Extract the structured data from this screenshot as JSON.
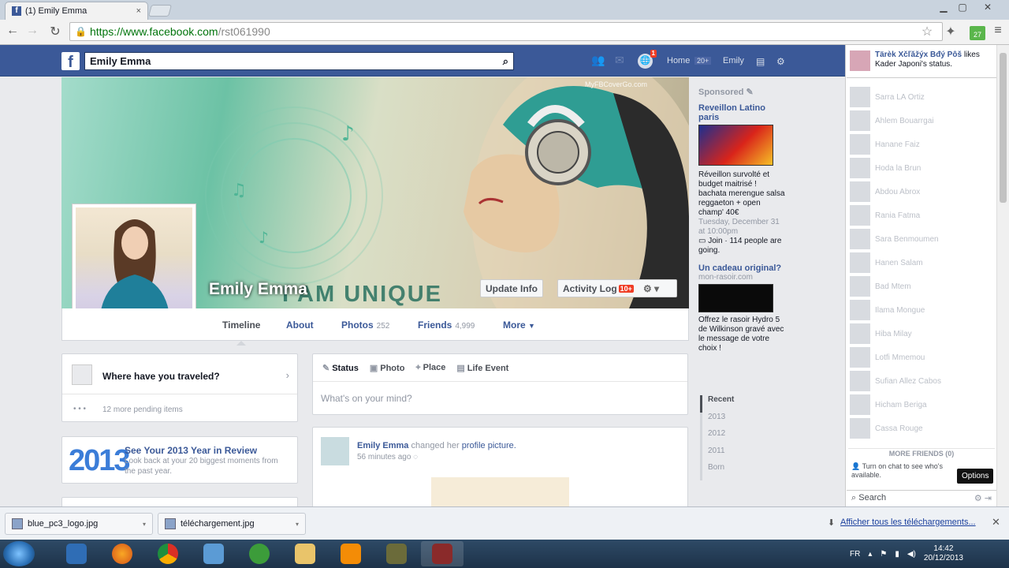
{
  "browser": {
    "tab_title": "(1) Emily Emma",
    "tab_close": "×",
    "url_host": "https://www.facebook.com",
    "url_path": "/rst061990",
    "extension_badge": "27"
  },
  "fb_header": {
    "logo": "f",
    "search_value": "Emily Emma",
    "notif_count": "1",
    "home_label": "Home",
    "home_count": "20+",
    "user_label": "Emily"
  },
  "cover": {
    "name": "Emily Emma",
    "overlay_text": "I AM UNIQUE",
    "watermark": "MyFBCoverGo.com",
    "update_info": "Update Info",
    "activity_log": "Activity Log",
    "activity_badge": "10+"
  },
  "profile_nav": {
    "timeline": "Timeline",
    "about": "About",
    "photos": "Photos",
    "photos_count": "252",
    "friends": "Friends",
    "friends_count": "4,999",
    "more": "More"
  },
  "travel_card": {
    "question": "Where have you traveled?",
    "pending": "12 more pending items"
  },
  "year_card": {
    "big": "2013",
    "title": "See Your 2013 Year in Review",
    "subtitle": "Look back at your 20 biggest moments from the past year."
  },
  "composer": {
    "status": "Status",
    "photo": "Photo",
    "place": "Place",
    "life_event": "Life Event",
    "placeholder": "What's on your mind?"
  },
  "story": {
    "author": "Emily Emma",
    "action": "changed her",
    "object": "profile picture.",
    "time": "56 minutes ago"
  },
  "ads": {
    "header": "Sponsored",
    "ad1_title": "Reveillon Latino paris",
    "ad1_body": "Réveillon survolté et budget maitrisé ! bachata merengue salsa reggaeton + open champ' 40€",
    "ad1_date": "Tuesday, December 31 at 10:00pm",
    "ad1_join": "Join · 114 people are going.",
    "ad2_title": "Un cadeau original?",
    "ad2_domain": "mon-rasoir.com",
    "ad2_body": "Offrez le rasoir Hydro 5 de Wilkinson gravé avec le message de votre choix !"
  },
  "years": [
    "Recent",
    "2013",
    "2012",
    "2011",
    "Born"
  ],
  "chat": {
    "ticker_name": "Tärèk Xčľǎžýx Bđý Pôš",
    "ticker_text": "likes Kader Japoni's status.",
    "friends": [
      "Sarra LA Ortiz",
      "Ahlem Bouarrgai",
      "Hanane Faiz",
      "Hoda la Brun",
      "Abdou Abrox",
      "Rania Fatma",
      "Sara Benmoumen",
      "Hanen Salam",
      "Bad Mtem",
      "Ilama Mongue",
      "Hiba Milay",
      "Lotfi Mmemou",
      "Sufian Allez Cabos",
      "Hicham Beriga",
      "Cassa Rouge"
    ],
    "more_friends": "MORE FRIENDS (0)",
    "turn_on": "Turn on chat to see who's available.",
    "options": "Options",
    "search": "Search"
  },
  "downloads": {
    "file1": "blue_pc3_logo.jpg",
    "file2": "téléchargement.jpg",
    "show_all": "Afficher tous les téléchargements..."
  },
  "taskbar": {
    "lang": "FR",
    "time": "14:42",
    "date": "20/12/2013"
  }
}
